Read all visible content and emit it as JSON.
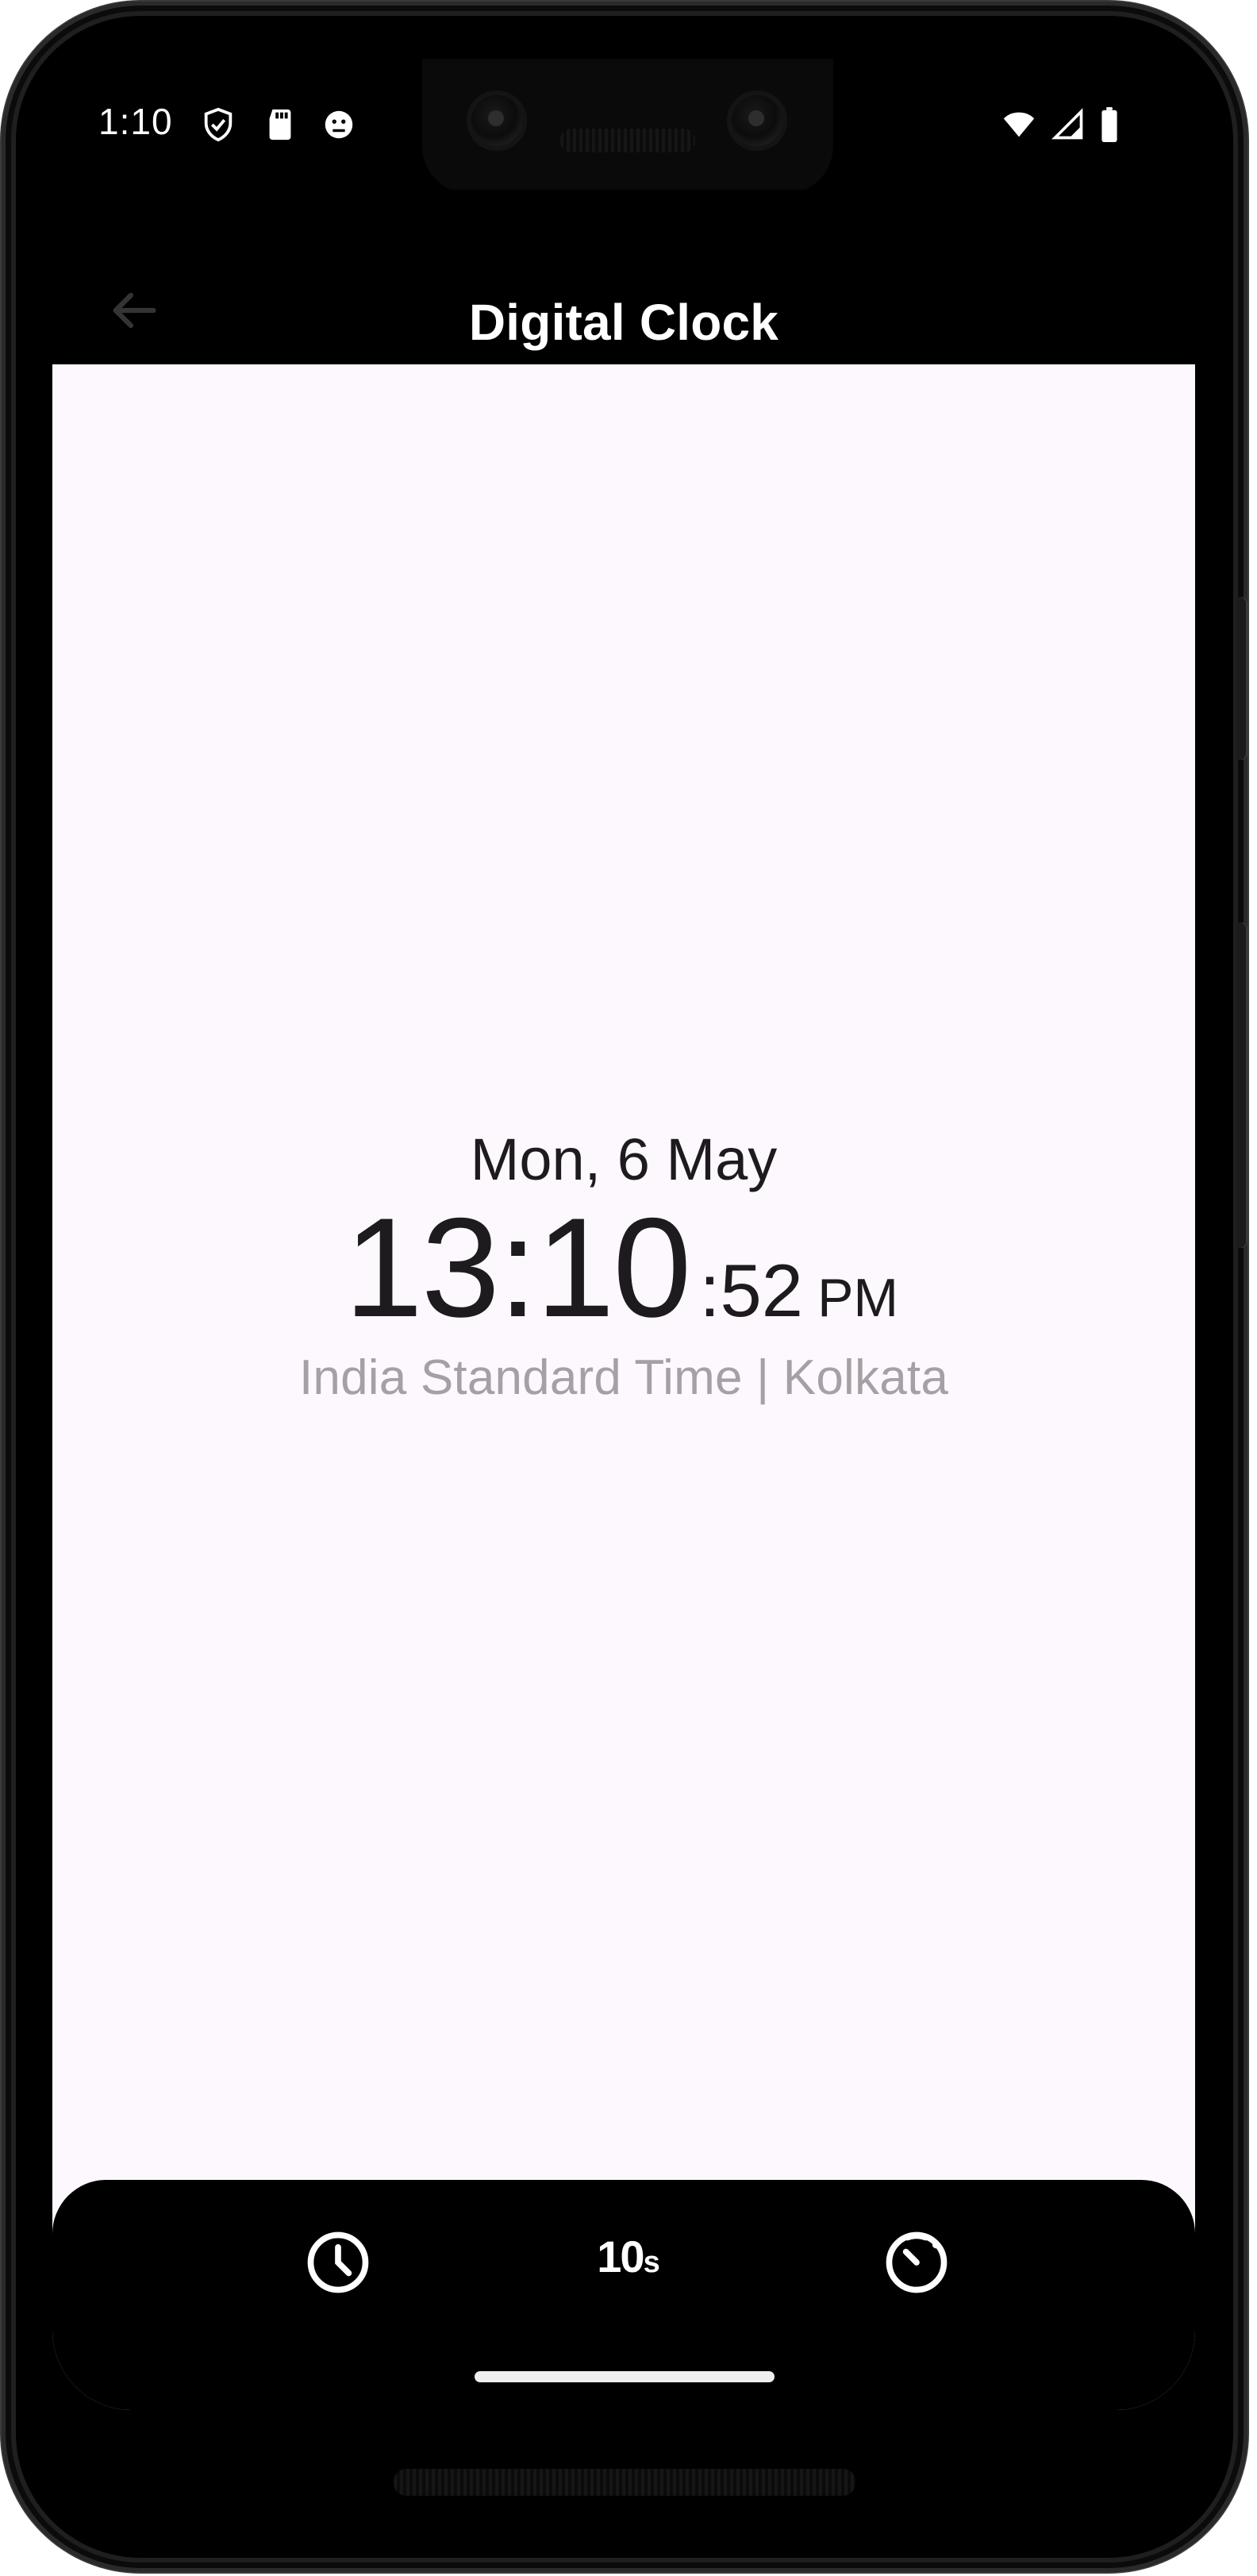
{
  "status_bar": {
    "time": "1:10",
    "icons": [
      "shield-icon",
      "sd-card-icon",
      "android-icon",
      "wifi-icon",
      "signal-icon",
      "battery-icon"
    ]
  },
  "app_bar": {
    "title": "Digital Clock",
    "back_icon": "arrow-back-icon"
  },
  "clock": {
    "date": "Mon, 6 May",
    "time_main": "13:10",
    "seconds": ":52",
    "ampm": "PM",
    "timezone": "India Standard Time | Kolkata"
  },
  "bottom_nav": {
    "items": [
      {
        "icon": "clock-icon"
      },
      {
        "label": "10",
        "sub": "s",
        "icon": "timer-text-icon"
      },
      {
        "icon": "stopwatch-icon"
      }
    ]
  },
  "colors": {
    "background": "#fdf8fd",
    "text_primary": "#1d1b1e",
    "text_secondary": "#a4a0a5",
    "bar_background": "#000000"
  }
}
